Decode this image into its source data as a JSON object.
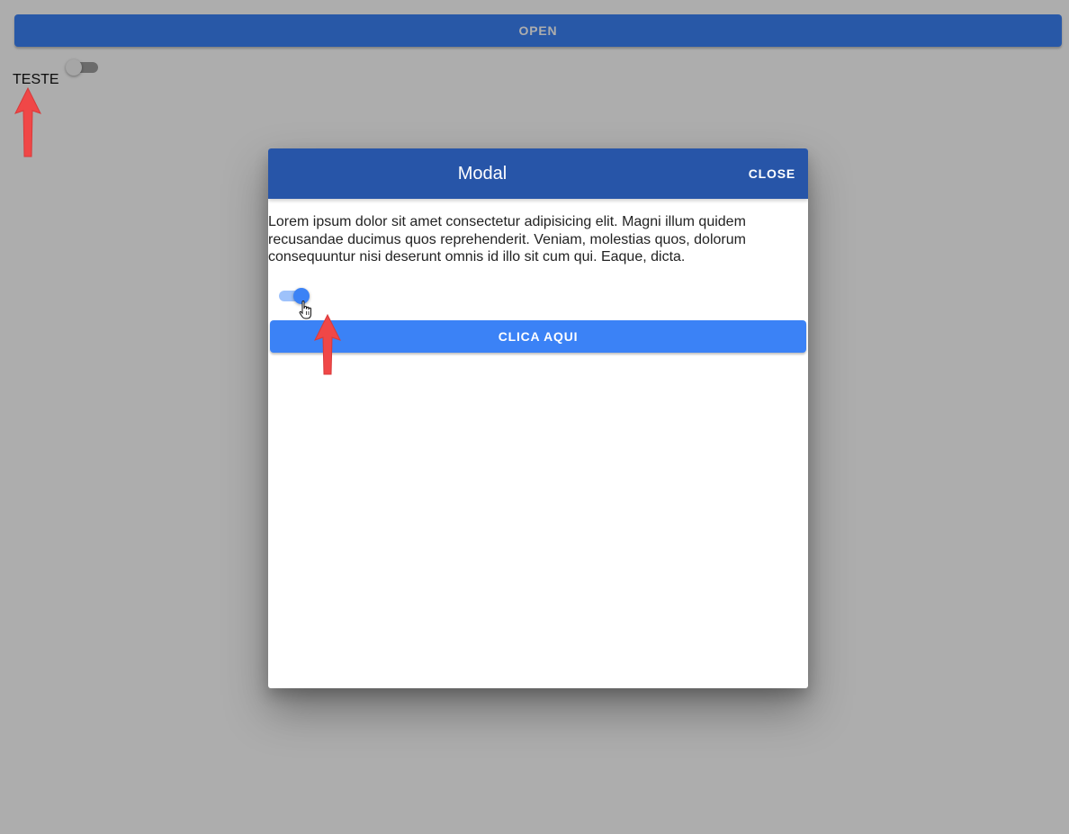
{
  "page": {
    "open_label": "OPEN",
    "toggle_label": "TESTE",
    "toggle_checked": false
  },
  "modal": {
    "title": "Modal",
    "close_label": "CLOSE",
    "body_text": "Lorem ipsum dolor sit amet consectetur adipisicing elit. Magni illum quidem recusandae ducimus quos reprehenderit. Veniam, molestias quos, dolorum consequuntur nisi deserunt omnis id illo sit cum qui. Eaque, dicta.",
    "toggle_checked": true,
    "action_label": "CLICA AQUI"
  },
  "icons": {
    "cursor": "hand-pointer-icon",
    "annotation": "red-arrow-up-icon"
  },
  "colors": {
    "primary": "#3b82f6",
    "header": "#2755a8",
    "overlay": "rgba(0,0,0,0.32)",
    "annotation_arrow": "#f04747"
  }
}
